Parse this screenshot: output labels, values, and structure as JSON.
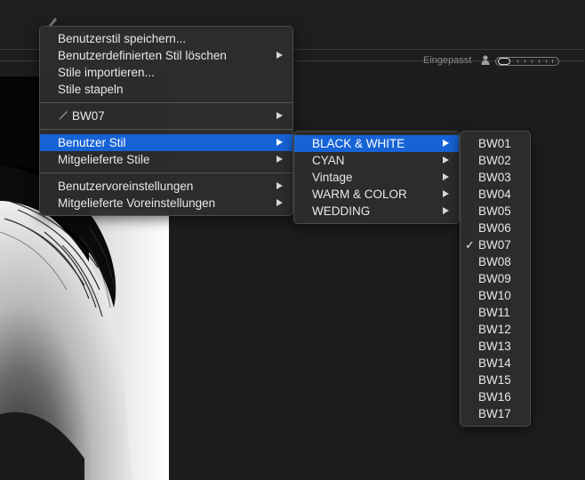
{
  "toolbar": {
    "fit_label": "Eingepasst"
  },
  "icons": {
    "brush": "brush-icon",
    "person": "person-icon",
    "pen": "pen-icon",
    "arrow": "chevron-right-icon",
    "check": "checkmark-icon"
  },
  "colors": {
    "selection": "#1663d6",
    "menu_bg": "#2c2c2c",
    "app_bg": "#1d1d1d"
  },
  "main_menu": {
    "group1": [
      {
        "label": "Benutzerstil speichern...",
        "submenu": false
      },
      {
        "label": "Benutzerdefinierten Stil löschen",
        "submenu": true
      },
      {
        "label": "Stile importieren...",
        "submenu": false
      },
      {
        "label": "Stile stapeln",
        "submenu": false
      }
    ],
    "current_style": {
      "label": "BW07",
      "submenu": true
    },
    "group2": [
      {
        "label": "Benutzer Stil",
        "submenu": true,
        "selected": true
      },
      {
        "label": "Mitgelieferte Stile",
        "submenu": true
      }
    ],
    "group3": [
      {
        "label": "Benutzervoreinstellungen",
        "submenu": true
      },
      {
        "label": "Mitgelieferte Voreinstellungen",
        "submenu": true
      }
    ]
  },
  "user_style_menu": [
    {
      "label": "BLACK & WHITE",
      "selected": true
    },
    {
      "label": "CYAN"
    },
    {
      "label": "Vintage"
    },
    {
      "label": "WARM & COLOR"
    },
    {
      "label": "WEDDING"
    }
  ],
  "bw_menu": {
    "checked": "BW07",
    "items": [
      "BW01",
      "BW02",
      "BW03",
      "BW04",
      "BW05",
      "BW06",
      "BW07",
      "BW08",
      "BW09",
      "BW10",
      "BW11",
      "BW12",
      "BW13",
      "BW14",
      "BW15",
      "BW16",
      "BW17"
    ]
  }
}
